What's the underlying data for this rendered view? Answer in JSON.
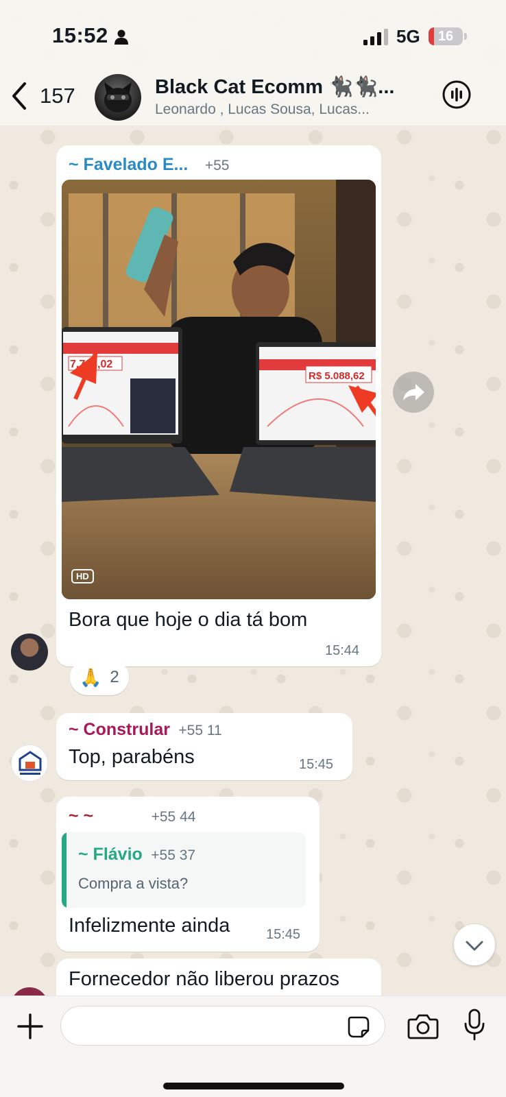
{
  "status_bar": {
    "time": "15:52",
    "network": "5G",
    "battery": "16",
    "battery_level": 0.16
  },
  "chat_header": {
    "back_count": "157",
    "title": "Black Cat Ecomm 🐈‍⬛🐈‍⬛...",
    "members": "Leonardo          , Lucas Sousa, Lucas..."
  },
  "messages": [
    {
      "sender": "~ Favelado E...",
      "sender_color": "#2a8bc4",
      "phone": "+55",
      "image_badge": "HD",
      "photo_values": [
        "7.763,02",
        "R$ 5.088,62"
      ],
      "text": "Bora que hoje o dia tá bom",
      "time": "15:44",
      "reaction_emoji": "🙏",
      "reaction_count": "2"
    },
    {
      "sender": "~ Constrular",
      "sender_color": "#a8195a",
      "phone": "+55 11",
      "text": "Top, parabéns",
      "time": "15:45"
    },
    {
      "sender": "~ ~",
      "sender_color": "#a02838",
      "phone": "+55 44",
      "quote_sender": "~ Flávio",
      "quote_sender_color": "#25a884",
      "quote_phone": "+55 37",
      "quote_text": "Compra a vista?",
      "text": "Infelizmente ainda",
      "time": "15:45"
    },
    {
      "text": "Fornecedor não liberou prazos"
    }
  ],
  "input": {
    "placeholder": ""
  },
  "icons": {
    "back": "chevron-left-icon",
    "call": "group-call-icon",
    "forward": "forward-icon",
    "scroll": "chevron-down-icon",
    "plus": "plus-icon",
    "sticker": "sticker-icon",
    "camera": "camera-icon",
    "mic": "microphone-icon"
  }
}
